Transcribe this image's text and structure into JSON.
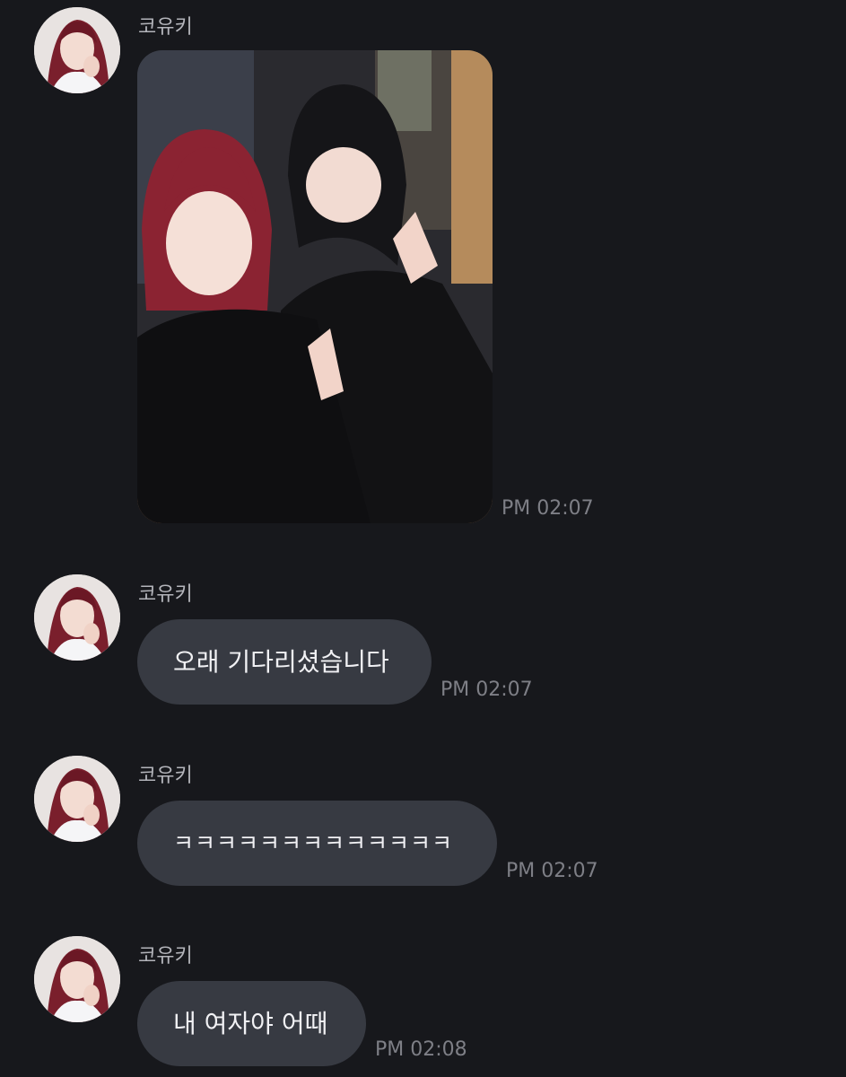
{
  "messages": [
    {
      "sender": "코유키",
      "kind": "image",
      "image_desc": "photo",
      "time": "PM 02:07"
    },
    {
      "sender": "코유키",
      "kind": "text",
      "text": "오래 기다리셨습니다",
      "time": "PM 02:07"
    },
    {
      "sender": "코유키",
      "kind": "text",
      "text": "ㅋㅋㅋㅋㅋㅋㅋㅋㅋㅋㅋㅋㅋ",
      "time": "PM 02:07"
    },
    {
      "sender": "코유키",
      "kind": "text",
      "text": "내 여자야 어때",
      "time": "PM 02:08"
    }
  ],
  "colors": {
    "background": "#17181c",
    "bubble": "#373a42",
    "timestamp": "#7e7f86",
    "sender": "#b3b4ba"
  }
}
